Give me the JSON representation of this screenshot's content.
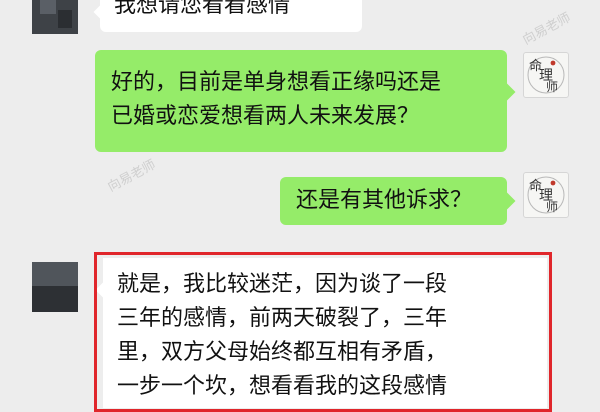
{
  "messages": [
    {
      "side": "left",
      "lines": [
        "我想请您看看感情"
      ]
    },
    {
      "side": "right",
      "lines": [
        "好的，目前是单身想看正缘吗还是",
        "已婚或恋爱想看两人未来发展？"
      ]
    },
    {
      "side": "right",
      "lines": [
        "还是有其他诉求？"
      ]
    },
    {
      "side": "left",
      "lines": [
        "就是，我比较迷茫，因为谈了一段",
        "三年的感情，前两天破裂了，三年",
        "里，双方父母始终都互相有矛盾，",
        "一步一个坎，想看看我的这段感情"
      ]
    }
  ],
  "avatar": {
    "line1": "命",
    "line2": "理",
    "line3": "师"
  },
  "watermark": "向易老师",
  "colors": {
    "green_bubble": "#95ec69",
    "white_bubble": "#ffffff",
    "highlight": "#e0262b",
    "background": "#ededed"
  }
}
